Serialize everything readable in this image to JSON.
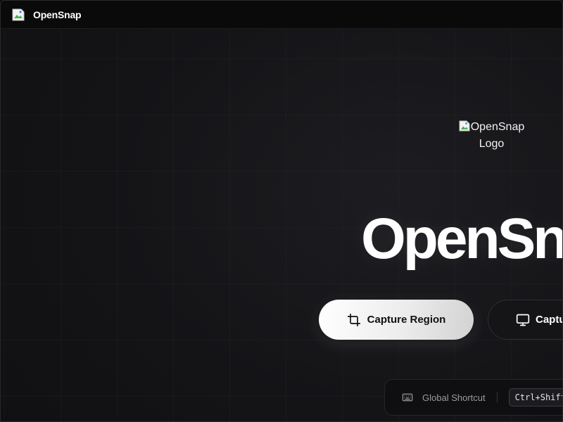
{
  "window": {
    "title": "OpenSnap",
    "icon": "broken-image-icon"
  },
  "hero": {
    "logo_alt": "OpenSnap Logo",
    "title": "OpenSnap"
  },
  "actions": {
    "capture_region_label": "Capture Region",
    "capture_region_icon": "crop-icon",
    "capture_screen_label": "Capture Screen",
    "capture_screen_icon": "monitor-icon"
  },
  "shortcut": {
    "label": "Global Shortcut",
    "icon": "keyboard-icon",
    "keys": "Ctrl+Shift+S"
  },
  "colors": {
    "background": "#0c0c0e",
    "titlebar": "#0a0a0b",
    "primary_button": "#ffffff",
    "primary_text": "#111114",
    "secondary_button": "#151518",
    "muted_text": "#9a9aa0"
  }
}
